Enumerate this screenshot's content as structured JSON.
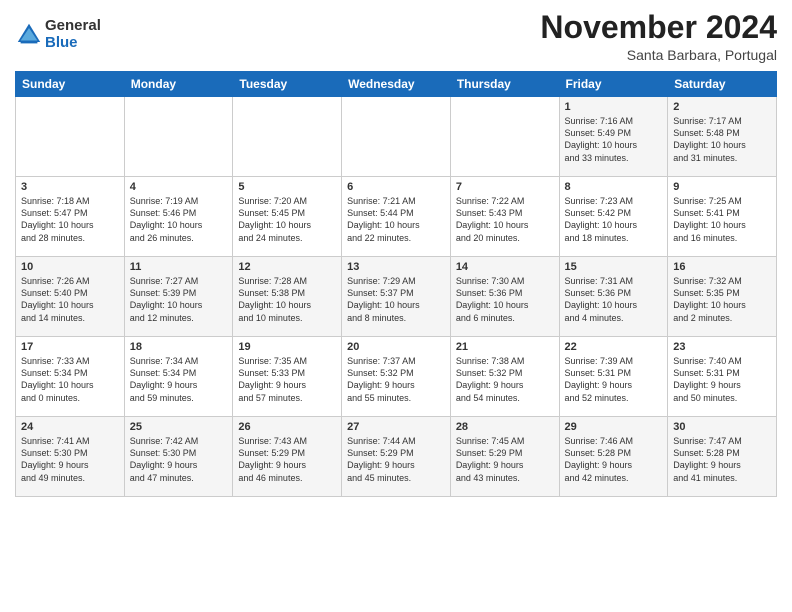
{
  "header": {
    "logo": {
      "general": "General",
      "blue": "Blue"
    },
    "title": "November 2024",
    "subtitle": "Santa Barbara, Portugal"
  },
  "calendar": {
    "weekdays": [
      "Sunday",
      "Monday",
      "Tuesday",
      "Wednesday",
      "Thursday",
      "Friday",
      "Saturday"
    ],
    "weeks": [
      [
        {
          "day": "",
          "info": ""
        },
        {
          "day": "",
          "info": ""
        },
        {
          "day": "",
          "info": ""
        },
        {
          "day": "",
          "info": ""
        },
        {
          "day": "",
          "info": ""
        },
        {
          "day": "1",
          "info": "Sunrise: 7:16 AM\nSunset: 5:49 PM\nDaylight: 10 hours\nand 33 minutes."
        },
        {
          "day": "2",
          "info": "Sunrise: 7:17 AM\nSunset: 5:48 PM\nDaylight: 10 hours\nand 31 minutes."
        }
      ],
      [
        {
          "day": "3",
          "info": "Sunrise: 7:18 AM\nSunset: 5:47 PM\nDaylight: 10 hours\nand 28 minutes."
        },
        {
          "day": "4",
          "info": "Sunrise: 7:19 AM\nSunset: 5:46 PM\nDaylight: 10 hours\nand 26 minutes."
        },
        {
          "day": "5",
          "info": "Sunrise: 7:20 AM\nSunset: 5:45 PM\nDaylight: 10 hours\nand 24 minutes."
        },
        {
          "day": "6",
          "info": "Sunrise: 7:21 AM\nSunset: 5:44 PM\nDaylight: 10 hours\nand 22 minutes."
        },
        {
          "day": "7",
          "info": "Sunrise: 7:22 AM\nSunset: 5:43 PM\nDaylight: 10 hours\nand 20 minutes."
        },
        {
          "day": "8",
          "info": "Sunrise: 7:23 AM\nSunset: 5:42 PM\nDaylight: 10 hours\nand 18 minutes."
        },
        {
          "day": "9",
          "info": "Sunrise: 7:25 AM\nSunset: 5:41 PM\nDaylight: 10 hours\nand 16 minutes."
        }
      ],
      [
        {
          "day": "10",
          "info": "Sunrise: 7:26 AM\nSunset: 5:40 PM\nDaylight: 10 hours\nand 14 minutes."
        },
        {
          "day": "11",
          "info": "Sunrise: 7:27 AM\nSunset: 5:39 PM\nDaylight: 10 hours\nand 12 minutes."
        },
        {
          "day": "12",
          "info": "Sunrise: 7:28 AM\nSunset: 5:38 PM\nDaylight: 10 hours\nand 10 minutes."
        },
        {
          "day": "13",
          "info": "Sunrise: 7:29 AM\nSunset: 5:37 PM\nDaylight: 10 hours\nand 8 minutes."
        },
        {
          "day": "14",
          "info": "Sunrise: 7:30 AM\nSunset: 5:36 PM\nDaylight: 10 hours\nand 6 minutes."
        },
        {
          "day": "15",
          "info": "Sunrise: 7:31 AM\nSunset: 5:36 PM\nDaylight: 10 hours\nand 4 minutes."
        },
        {
          "day": "16",
          "info": "Sunrise: 7:32 AM\nSunset: 5:35 PM\nDaylight: 10 hours\nand 2 minutes."
        }
      ],
      [
        {
          "day": "17",
          "info": "Sunrise: 7:33 AM\nSunset: 5:34 PM\nDaylight: 10 hours\nand 0 minutes."
        },
        {
          "day": "18",
          "info": "Sunrise: 7:34 AM\nSunset: 5:34 PM\nDaylight: 9 hours\nand 59 minutes."
        },
        {
          "day": "19",
          "info": "Sunrise: 7:35 AM\nSunset: 5:33 PM\nDaylight: 9 hours\nand 57 minutes."
        },
        {
          "day": "20",
          "info": "Sunrise: 7:37 AM\nSunset: 5:32 PM\nDaylight: 9 hours\nand 55 minutes."
        },
        {
          "day": "21",
          "info": "Sunrise: 7:38 AM\nSunset: 5:32 PM\nDaylight: 9 hours\nand 54 minutes."
        },
        {
          "day": "22",
          "info": "Sunrise: 7:39 AM\nSunset: 5:31 PM\nDaylight: 9 hours\nand 52 minutes."
        },
        {
          "day": "23",
          "info": "Sunrise: 7:40 AM\nSunset: 5:31 PM\nDaylight: 9 hours\nand 50 minutes."
        }
      ],
      [
        {
          "day": "24",
          "info": "Sunrise: 7:41 AM\nSunset: 5:30 PM\nDaylight: 9 hours\nand 49 minutes."
        },
        {
          "day": "25",
          "info": "Sunrise: 7:42 AM\nSunset: 5:30 PM\nDaylight: 9 hours\nand 47 minutes."
        },
        {
          "day": "26",
          "info": "Sunrise: 7:43 AM\nSunset: 5:29 PM\nDaylight: 9 hours\nand 46 minutes."
        },
        {
          "day": "27",
          "info": "Sunrise: 7:44 AM\nSunset: 5:29 PM\nDaylight: 9 hours\nand 45 minutes."
        },
        {
          "day": "28",
          "info": "Sunrise: 7:45 AM\nSunset: 5:29 PM\nDaylight: 9 hours\nand 43 minutes."
        },
        {
          "day": "29",
          "info": "Sunrise: 7:46 AM\nSunset: 5:28 PM\nDaylight: 9 hours\nand 42 minutes."
        },
        {
          "day": "30",
          "info": "Sunrise: 7:47 AM\nSunset: 5:28 PM\nDaylight: 9 hours\nand 41 minutes."
        }
      ]
    ]
  }
}
